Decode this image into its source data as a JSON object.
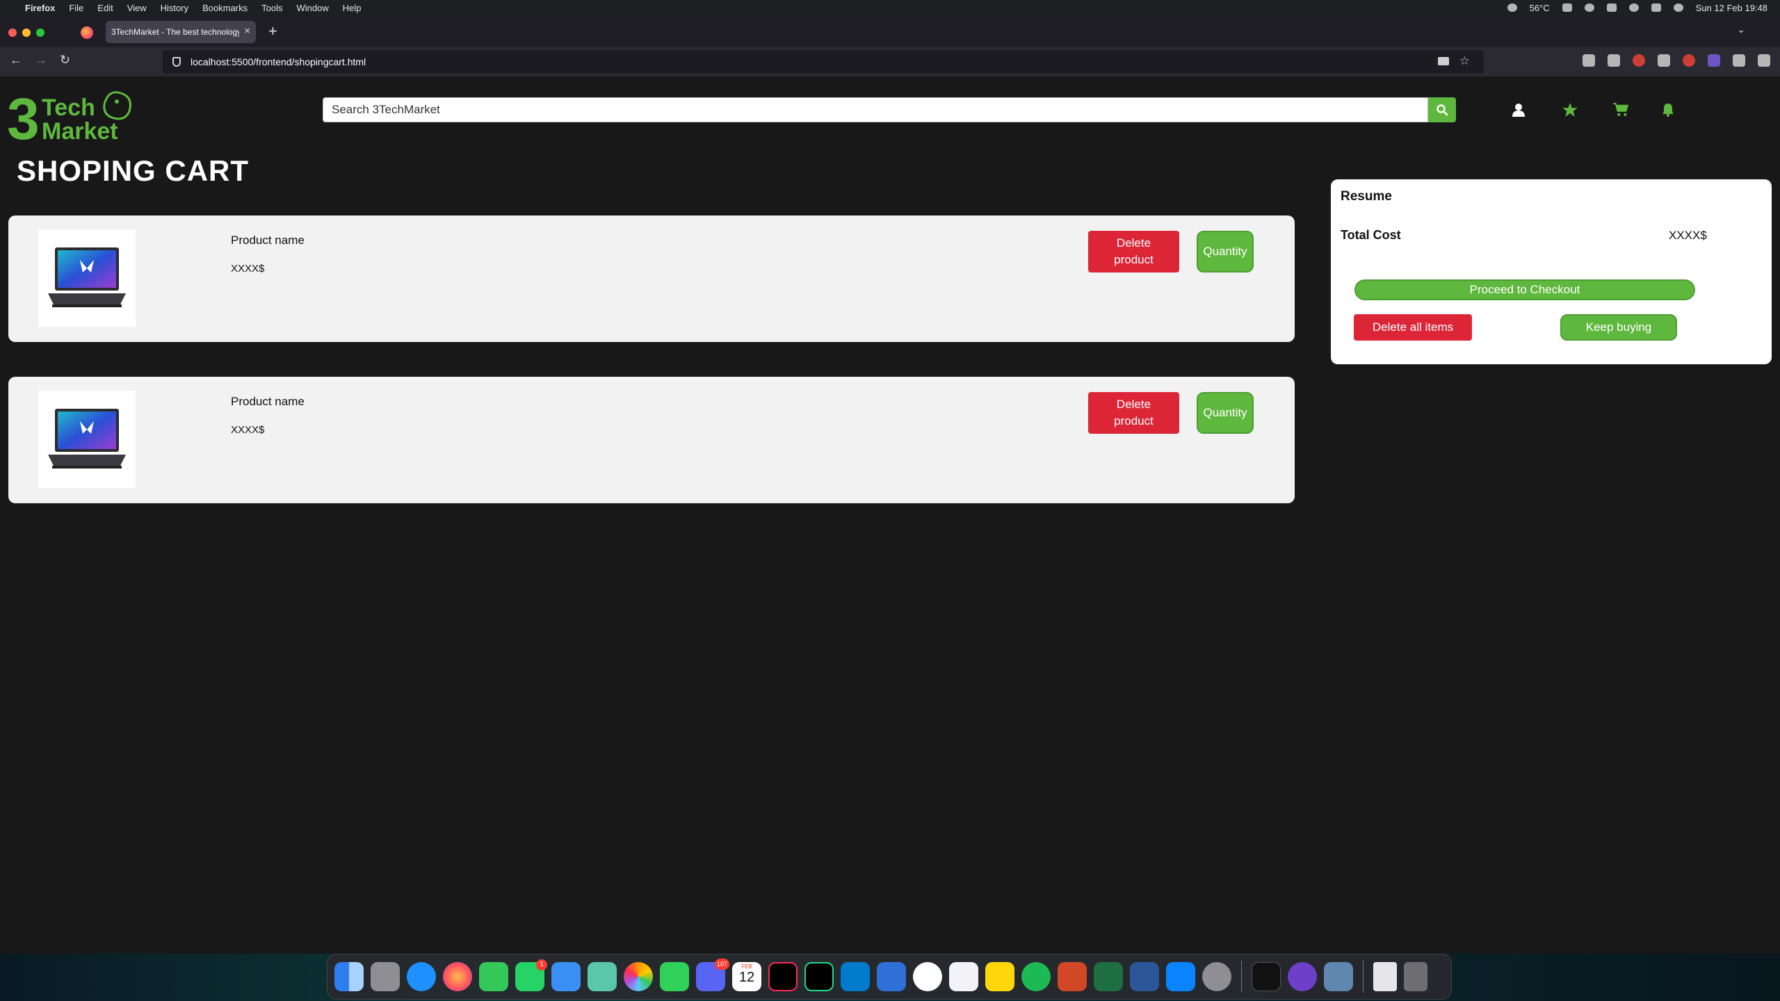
{
  "menubar": {
    "app_name": "Firefox",
    "menus": [
      "File",
      "Edit",
      "View",
      "History",
      "Bookmarks",
      "Tools",
      "Window",
      "Help"
    ],
    "temperature": "56°C",
    "datetime": "Sun 12 Feb  19:48"
  },
  "browser": {
    "tab_title": "3TechMarket - The best technology",
    "url": "localhost:5500/frontend/shopingcart.html"
  },
  "header": {
    "logo_line1": "Tech",
    "logo_line2": "Market",
    "logo_digit": "3",
    "search_placeholder": "Search 3TechMarket"
  },
  "main": {
    "page_title": "SHOPING CART",
    "cart_items": [
      {
        "name": "Product name",
        "price": "XXXX$",
        "delete_label_1": "Delete",
        "delete_label_2": "product",
        "quantity_label": "Quantity"
      },
      {
        "name": "Product name",
        "price": "XXXX$",
        "delete_label_1": "Delete",
        "delete_label_2": "product",
        "quantity_label": "Quantity"
      }
    ]
  },
  "resume": {
    "title": "Resume",
    "total_label": "Total Cost",
    "total_value": "XXXX$",
    "checkout_label": "Proceed to Checkout",
    "delete_all_label": "Delete all items",
    "keep_buying_label": "Keep buying"
  },
  "dock": {
    "calendar_month": "FEB",
    "calendar_day": "12",
    "discord_badge": "107",
    "whatsapp_badge": "1"
  },
  "colors": {
    "accent_green": "#5fb83e",
    "danger_red": "#dc2638",
    "page_background": "#181818"
  }
}
